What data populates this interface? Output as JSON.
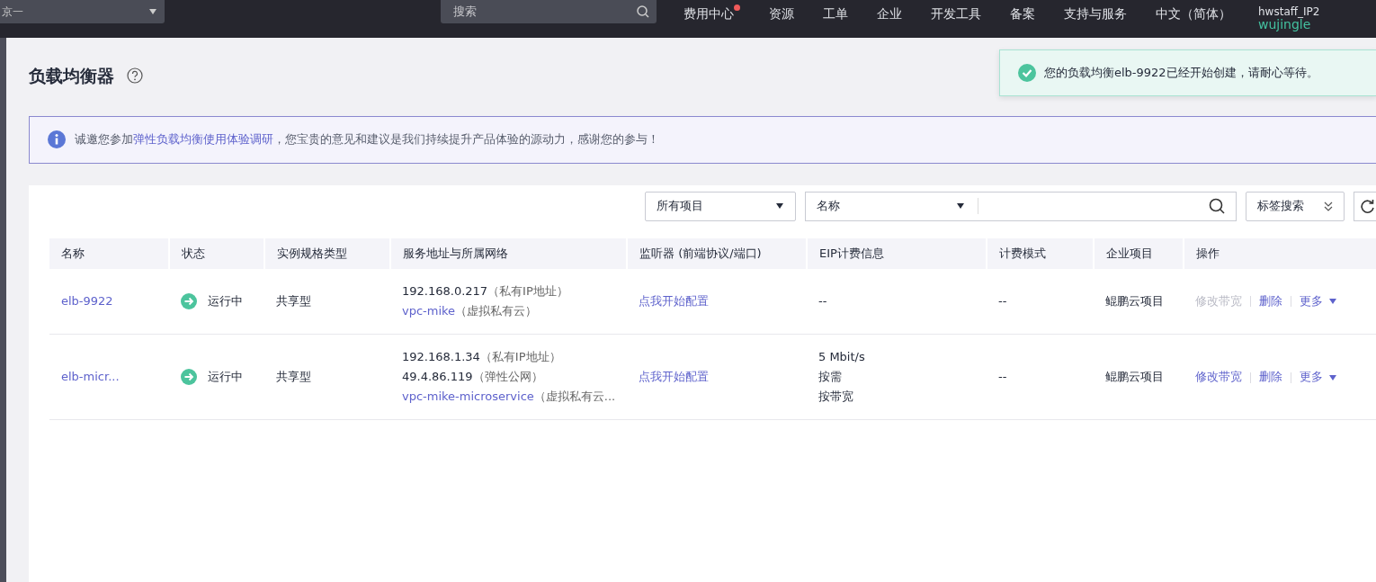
{
  "top_bar": {
    "region_selector": "京一",
    "search": {
      "placeholder": "搜索"
    },
    "nav": [
      {
        "label": "费用中心",
        "notification": true
      },
      {
        "label": "资源",
        "notification": false
      },
      {
        "label": "工单",
        "notification": false
      },
      {
        "label": "企业",
        "notification": false
      },
      {
        "label": "开发工具",
        "notification": false
      },
      {
        "label": "备案",
        "notification": false
      },
      {
        "label": "支持与服务",
        "notification": false
      },
      {
        "label": "中文（简体）",
        "notification": false
      }
    ],
    "user": {
      "account": "hwstaff_IP2",
      "name": "wujingle"
    }
  },
  "page": {
    "title": "负载均衡器"
  },
  "toast": {
    "text": "您的负载均衡elb-9922已经开始创建，请耐心等待。"
  },
  "info_banner": {
    "before": "诚邀您参加",
    "link": "弹性负载均衡使用体验调研",
    "after": "，您宝贵的意见和建议是我们持续提升产品体验的源动力，感谢您的参与！"
  },
  "filters": {
    "project": "所有项目",
    "attribute": "名称",
    "tag_search": "标签搜索"
  },
  "table": {
    "columns": [
      "名称",
      "状态",
      "实例规格类型",
      "服务地址与所属网络",
      "监听器 (前端协议/端口)",
      "EIP计费信息",
      "计费模式",
      "企业项目",
      "操作"
    ],
    "rows": [
      {
        "name": "elb-9922",
        "status": "运行中",
        "type": "共享型",
        "address": [
          {
            "value": "192.168.0.217",
            "note": "（私有IP地址）",
            "link": false
          },
          {
            "value": "vpc-mike",
            "note": "（虚拟私有云）",
            "link": true
          }
        ],
        "listener": "点我开始配置",
        "eip": [
          "--"
        ],
        "billing": "--",
        "project": "鲲鹏云项目",
        "actions": [
          {
            "label": "修改带宽",
            "kind": "link",
            "disabled": true
          },
          {
            "label": "删除",
            "kind": "link",
            "disabled": false
          },
          {
            "label": "更多",
            "kind": "dropdown",
            "disabled": false
          }
        ]
      },
      {
        "name": "elb-micr...",
        "status": "运行中",
        "type": "共享型",
        "address": [
          {
            "value": "192.168.1.34",
            "note": "（私有IP地址）",
            "link": false
          },
          {
            "value": "49.4.86.119",
            "note": "（弹性公网）",
            "link": false
          },
          {
            "value": "vpc-mike-microservice",
            "note": "（虚拟私有云...",
            "link": true
          }
        ],
        "listener": "点我开始配置",
        "eip": [
          "5 Mbit/s",
          "按需",
          "按带宽"
        ],
        "billing": "--",
        "project": "鲲鹏云项目",
        "actions": [
          {
            "label": "修改带宽",
            "kind": "link",
            "disabled": false
          },
          {
            "label": "删除",
            "kind": "link",
            "disabled": false
          },
          {
            "label": "更多",
            "kind": "dropdown",
            "disabled": false
          }
        ]
      }
    ]
  }
}
